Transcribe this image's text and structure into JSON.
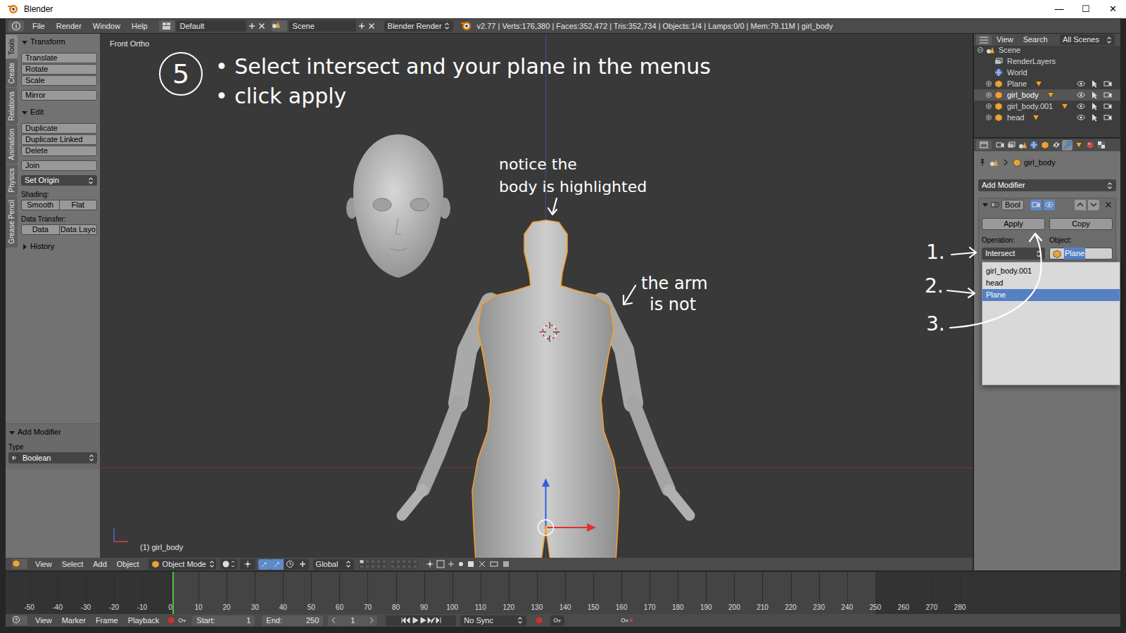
{
  "window": {
    "title": "Blender",
    "controls": [
      "—",
      "☐",
      "✕"
    ]
  },
  "info_header": {
    "menus": [
      "File",
      "Render",
      "Window",
      "Help"
    ],
    "layout": "Default",
    "scene": "Scene",
    "engine": "Blender Render",
    "stats": "v2.77 | Verts:176,380 | Faces:352,472 | Tris:352,734 | Objects:1/4 | Lamps:0/0 | Mem:79.11M | girl_body"
  },
  "tool_shelf": {
    "tabs": [
      {
        "label": "Tools",
        "selected": true
      },
      {
        "label": "Create",
        "selected": false
      },
      {
        "label": "Relations",
        "selected": false
      },
      {
        "label": "Animation",
        "selected": false
      },
      {
        "label": "Physics",
        "selected": false
      },
      {
        "label": "Grease Pencil",
        "selected": false
      }
    ],
    "panels": [
      {
        "title": "Transform",
        "expanded": true,
        "groups": [
          [
            {
              "kind": "button",
              "label": "Translate"
            },
            {
              "kind": "button",
              "label": "Rotate"
            },
            {
              "kind": "button",
              "label": "Scale"
            }
          ],
          [
            {
              "kind": "button",
              "label": "Mirror"
            }
          ]
        ]
      },
      {
        "title": "Edit",
        "expanded": true,
        "groups": [
          [
            {
              "kind": "button",
              "label": "Duplicate"
            },
            {
              "kind": "button",
              "label": "Duplicate Linked"
            },
            {
              "kind": "button",
              "label": "Delete"
            }
          ],
          [
            {
              "kind": "button",
              "label": "Join"
            }
          ],
          [
            {
              "kind": "dropdown",
              "label": "Set Origin"
            }
          ],
          [
            {
              "kind": "label",
              "label": "Shading:"
            },
            {
              "kind": "pair",
              "items": [
                "Smooth",
                "Flat"
              ]
            }
          ],
          [
            {
              "kind": "label",
              "label": "Data Transfer:"
            },
            {
              "kind": "pair",
              "items": [
                "Data",
                "Data Layo"
              ]
            }
          ]
        ]
      },
      {
        "title": "History",
        "expanded": false,
        "groups": []
      }
    ],
    "operator": {
      "title": "Add Modifier",
      "expanded": true,
      "label": "Type",
      "value": "Boolean"
    }
  },
  "viewport": {
    "view_name": "Front Ortho",
    "object_info": "(1) girl_body",
    "figures": [
      {
        "kind": "body",
        "selected": true
      },
      {
        "kind": "head",
        "selected": false
      },
      {
        "kind": "arms",
        "selected": false
      }
    ]
  },
  "annotations": {
    "step": "5",
    "lines": [
      "• Select intersect and your plane in the menus",
      "• click apply"
    ],
    "notes": [
      {
        "lines": [
          "notice the",
          "body is highlighted"
        ]
      },
      {
        "lines": [
          "the arm",
          "is not"
        ]
      }
    ],
    "markers": [
      "1.",
      "2.",
      "3."
    ]
  },
  "viewport_header": {
    "menus": [
      "View",
      "Select",
      "Add",
      "Object"
    ],
    "mode": "Object Mode",
    "orientation": "Global"
  },
  "timeline": {
    "ticks": [
      "-50",
      "-40",
      "-30",
      "-20",
      "-10",
      "0",
      "10",
      "20",
      "30",
      "40",
      "50",
      "60",
      "70",
      "80",
      "90",
      "100",
      "110",
      "120",
      "130",
      "140",
      "150",
      "160",
      "170",
      "180",
      "190",
      "200",
      "210",
      "220",
      "230",
      "240",
      "250",
      "260",
      "270",
      "280"
    ],
    "menus": [
      "View",
      "Marker",
      "Frame",
      "Playback"
    ],
    "start_label": "Start:",
    "start": "1",
    "end_label": "End:",
    "end": "250",
    "current": "1",
    "sync": "No Sync"
  },
  "outliner": {
    "menus": [
      "View",
      "Search"
    ],
    "filter": "All Scenes",
    "items": [
      {
        "label": "Scene",
        "kind": "scene",
        "depth": 0,
        "active": false
      },
      {
        "label": "RenderLayers",
        "kind": "renderlayers",
        "depth": 1,
        "active": false
      },
      {
        "label": "World",
        "kind": "world",
        "depth": 1,
        "active": false
      },
      {
        "label": "Plane",
        "kind": "object",
        "depth": 1,
        "active": false
      },
      {
        "label": "girl_body",
        "kind": "object",
        "depth": 1,
        "active": true
      },
      {
        "label": "girl_body.001",
        "kind": "object",
        "depth": 1,
        "active": false
      },
      {
        "label": "head",
        "kind": "object",
        "depth": 1,
        "active": false
      }
    ]
  },
  "properties": {
    "tabs": [
      {
        "kind": "render",
        "selected": false
      },
      {
        "kind": "render_layers",
        "selected": false
      },
      {
        "kind": "scene",
        "selected": false
      },
      {
        "kind": "world",
        "selected": false
      },
      {
        "kind": "object",
        "selected": false
      },
      {
        "kind": "constraints",
        "selected": false
      },
      {
        "kind": "modifiers",
        "selected": true
      },
      {
        "kind": "data",
        "selected": false
      },
      {
        "kind": "material",
        "selected": false
      },
      {
        "kind": "texture",
        "selected": false
      }
    ],
    "context": "girl_body",
    "add_modifier": "Add Modifier",
    "modifier": {
      "name": "Bool",
      "expanded": true,
      "apply": "Apply",
      "copy": "Copy",
      "operation_label": "Operation:",
      "operation": "Intersect",
      "object_label": "Object:",
      "object": "Plane",
      "object_editing": true
    },
    "search_results": [
      {
        "label": "girl_body.001",
        "selected": false
      },
      {
        "label": "head",
        "selected": false
      },
      {
        "label": "Plane",
        "selected": true
      }
    ]
  }
}
